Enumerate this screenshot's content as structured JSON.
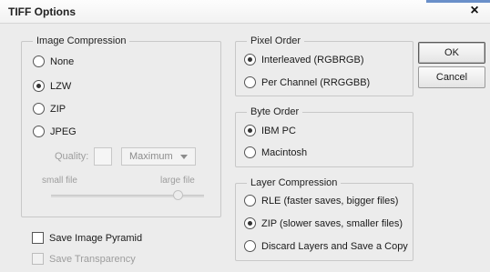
{
  "window": {
    "title": "TIFF Options",
    "close_glyph": "×"
  },
  "image_compression": {
    "legend": "Image Compression",
    "options": [
      {
        "label": "None",
        "checked": false
      },
      {
        "label": "LZW",
        "checked": true
      },
      {
        "label": "ZIP",
        "checked": false
      },
      {
        "label": "JPEG",
        "checked": false
      }
    ],
    "quality_label": "Quality:",
    "quality_value": "",
    "quality_select": "Maximum",
    "small_file_label": "small file",
    "large_file_label": "large file",
    "slider_level": 0.85
  },
  "pixel_order": {
    "legend": "Pixel Order",
    "options": [
      {
        "label": "Interleaved (RGBRGB)",
        "checked": true
      },
      {
        "label": "Per Channel (RRGGBB)",
        "checked": false
      }
    ]
  },
  "byte_order": {
    "legend": "Byte Order",
    "options": [
      {
        "label": "IBM PC",
        "checked": true
      },
      {
        "label": "Macintosh",
        "checked": false
      }
    ]
  },
  "layer_compression": {
    "legend": "Layer Compression",
    "options": [
      {
        "label": "RLE (faster saves, bigger files)",
        "checked": false
      },
      {
        "label": "ZIP (slower saves, smaller files)",
        "checked": true
      },
      {
        "label": "Discard Layers and Save a Copy",
        "checked": false
      }
    ]
  },
  "checkboxes": {
    "save_image_pyramid": {
      "label": "Save Image Pyramid",
      "checked": false,
      "enabled": true
    },
    "save_transparency": {
      "label": "Save Transparency",
      "checked": false,
      "enabled": false
    }
  },
  "buttons": {
    "ok": "OK",
    "cancel": "Cancel"
  },
  "colors": {
    "accent_strip": "#6a8fc9",
    "panel_bg": "#ececec"
  }
}
